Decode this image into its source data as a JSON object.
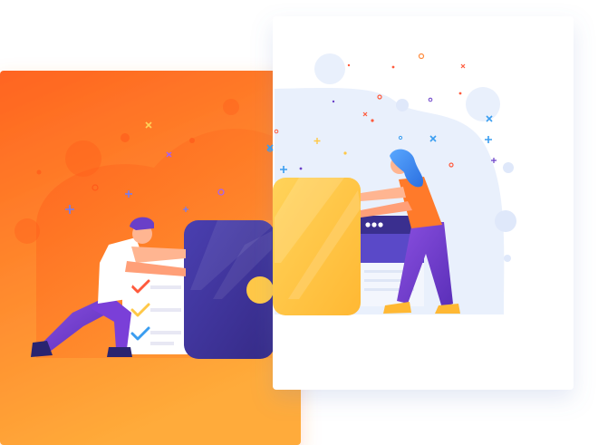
{
  "scene": {
    "description_icons": [
      "sparkle-icon",
      "cross-icon",
      "circle-icon"
    ],
    "colors": {
      "orange_start": "#ff6a1f",
      "orange_end": "#ffad3b",
      "purple": "#6a3fc8",
      "navy": "#3a2f8f",
      "wallet_yellow": "#ffc847",
      "blue_hair": "#3a8df0",
      "soft_blue": "#e8effc",
      "check_red": "#ff5a3c",
      "check_yellow": "#ffc847",
      "check_blue": "#3a9df0",
      "card_white": "#ffffff"
    },
    "browser_dots": 3,
    "checklist_items": 3
  }
}
